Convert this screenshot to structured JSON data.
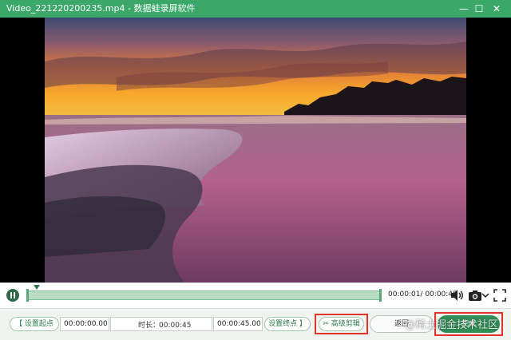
{
  "window": {
    "title": "Video_221220200235.mp4 - 数据蛙录屏软件",
    "minimize_glyph": "—",
    "maximize_glyph": "☐",
    "close_glyph": "✕"
  },
  "player": {
    "current_time": "00:00:01",
    "total_time": "00:00:45",
    "time_separator": "/ "
  },
  "trim": {
    "set_start_label": "【 设置起点",
    "start_time": "00:00:00.00",
    "duration_label": "时长：",
    "duration": "00:00:45",
    "end_time": "00:00:45.00",
    "set_end_label": "设置终点 】",
    "advanced_label": "高级剪辑"
  },
  "actions": {
    "back_label": "返回",
    "done_label": "完成"
  },
  "watermark": "@稀土掘金技术社区",
  "colors": {
    "titlebar": "#3ba869",
    "accent": "#2f8f57",
    "highlight": "#e0342b"
  }
}
